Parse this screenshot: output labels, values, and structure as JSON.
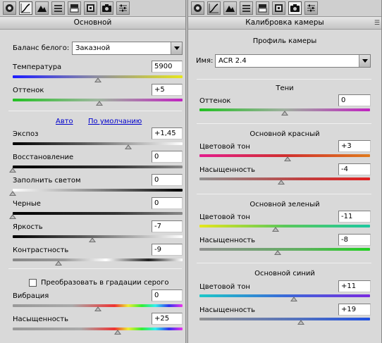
{
  "left": {
    "header": "Основной",
    "white_balance": {
      "label": "Баланс белого:",
      "value": "Заказной"
    },
    "sliders_top": [
      {
        "label": "Температура",
        "value": "5900",
        "level": 0.5
      },
      {
        "label": "Оттенок",
        "value": "+5",
        "level": 0.51
      }
    ],
    "links": {
      "auto": "Авто",
      "default": "По умолчанию"
    },
    "sliders_mid": [
      {
        "label": "Экспоз",
        "value": "+1,45",
        "level": 0.68
      },
      {
        "label": "Восстановление",
        "value": "0",
        "level": 0.0
      },
      {
        "label": "Заполнить светом",
        "value": "0",
        "level": 0.0
      },
      {
        "label": "Черные",
        "value": "0",
        "level": 0.0
      },
      {
        "label": "Яркость",
        "value": "-7",
        "level": 0.47
      },
      {
        "label": "Контрастность",
        "value": "-9",
        "level": 0.27
      }
    ],
    "grayscale": {
      "label": "Преобразовать в градации серого",
      "checked": false
    },
    "sliders_bottom": [
      {
        "label": "Вибрация",
        "value": "0",
        "level": 0.5
      },
      {
        "label": "Насыщенность",
        "value": "+25",
        "level": 0.62
      }
    ]
  },
  "right": {
    "header": "Калибровка камеры",
    "profile_title": "Профиль камеры",
    "name_label": "Имя:",
    "name_value": "ACR 2.4",
    "shadows": {
      "title": "Тени",
      "tint": {
        "label": "Оттенок",
        "value": "0",
        "level": 0.5
      }
    },
    "red": {
      "title": "Основной красный",
      "hue": {
        "label": "Цветовой тон",
        "value": "+3",
        "level": 0.515
      },
      "sat": {
        "label": "Насыщенность",
        "value": "-4",
        "level": 0.48
      }
    },
    "green": {
      "title": "Основной зеленый",
      "hue": {
        "label": "Цветовой тон",
        "value": "-11",
        "level": 0.445
      },
      "sat": {
        "label": "Насыщенность",
        "value": "-8",
        "level": 0.46
      }
    },
    "blue": {
      "title": "Основной синий",
      "hue": {
        "label": "Цветовой тон",
        "value": "+11",
        "level": 0.555
      },
      "sat": {
        "label": "Насыщенность",
        "value": "+19",
        "level": 0.595
      }
    }
  },
  "toolbar_icons": [
    "aperture-icon",
    "tone-curve-icon",
    "detail-icon",
    "hsl-icon",
    "split-toning-icon",
    "lens-icon",
    "camera-calibration-icon",
    "presets-icon"
  ],
  "colors": {
    "link": "#0000cc",
    "panel": "#d9d9d9"
  }
}
